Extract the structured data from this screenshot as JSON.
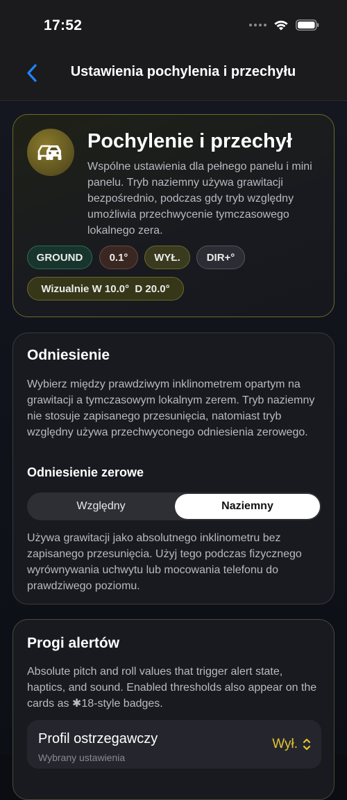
{
  "status_bar": {
    "time": "17:52"
  },
  "nav": {
    "title": "Ustawienia pochylenia i przechyłu"
  },
  "hero": {
    "title": "Pochylenie i przechył",
    "description": "Wspólne ustawienia dla pełnego panelu i mini panelu. Tryb naziemny używa grawitacji bezpośrednio, podczas gdy tryb względny umożliwia przechwycenie tymczasowego lokalnego zera.",
    "chips": {
      "ground": "GROUND",
      "step": "0.1°",
      "off": "WYŁ.",
      "dir": "DIR+°",
      "visual": "Wizualnie W 10.0°  D 20.0°"
    }
  },
  "reference": {
    "title": "Odniesienie",
    "description": "Wybierz między prawdziwym inklinometrem opartym na grawitacji a tymczasowym lokalnym zerem. Tryb naziemny nie stosuje zapisanego przesunięcia, natomiast tryb względny używa przechwyconego odniesienia zerowego.",
    "zero_label": "Odniesienie zerowe",
    "options": [
      "Względny",
      "Naziemny"
    ],
    "selected": "Naziemny",
    "help": "Używa grawitacji jako absolutnego inklinometru bez zapisanego przesunięcia. Użyj tego podczas fizycznego wyrównywania uchwytu lub mocowania telefonu do prawdziwego poziomu."
  },
  "alerts": {
    "title": "Progi alertów",
    "description": "Absolute pitch and roll values that trigger alert state, haptics, and sound. Enabled thresholds also appear on the cards as ✱18-style badges.",
    "profile_label": "Profil ostrzegawczy",
    "profile_sub": "Wybrany ustawienia",
    "profile_value": "Wył."
  },
  "colors": {
    "accent_blue": "#1e84ff",
    "accent_yellow": "#e8c532",
    "hero_border": "#6b6a2a"
  },
  "icons": {
    "back": "chevron-left-icon",
    "hero": "cars-icon",
    "wifi": "wifi-icon",
    "battery": "battery-icon",
    "signal": "signal-dots-icon",
    "profile_chevron": "chevron-up-down-icon"
  }
}
